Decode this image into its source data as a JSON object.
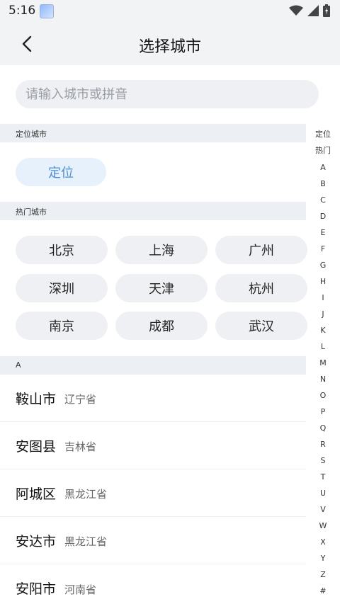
{
  "status": {
    "time": "5:16"
  },
  "header": {
    "title": "选择城市"
  },
  "search": {
    "placeholder": "请输入城市或拼音"
  },
  "sections": {
    "location": "定位城市",
    "hot": "热门城市",
    "a": "A"
  },
  "locate": {
    "label": "定位"
  },
  "hot_cities": [
    "北京",
    "上海",
    "广州",
    "深圳",
    "天津",
    "杭州",
    "南京",
    "成都",
    "武汉"
  ],
  "cities": [
    {
      "name": "鞍山市",
      "province": "辽宁省"
    },
    {
      "name": "安图县",
      "province": "吉林省"
    },
    {
      "name": "阿城区",
      "province": "黑龙江省"
    },
    {
      "name": "安达市",
      "province": "黑龙江省"
    },
    {
      "name": "安阳市",
      "province": "河南省"
    }
  ],
  "index": [
    "定位",
    "热门",
    "A",
    "B",
    "C",
    "D",
    "E",
    "F",
    "G",
    "H",
    "I",
    "J",
    "K",
    "L",
    "M",
    "N",
    "O",
    "P",
    "Q",
    "R",
    "S",
    "T",
    "U",
    "V",
    "W",
    "X",
    "Y",
    "Z",
    "#"
  ]
}
